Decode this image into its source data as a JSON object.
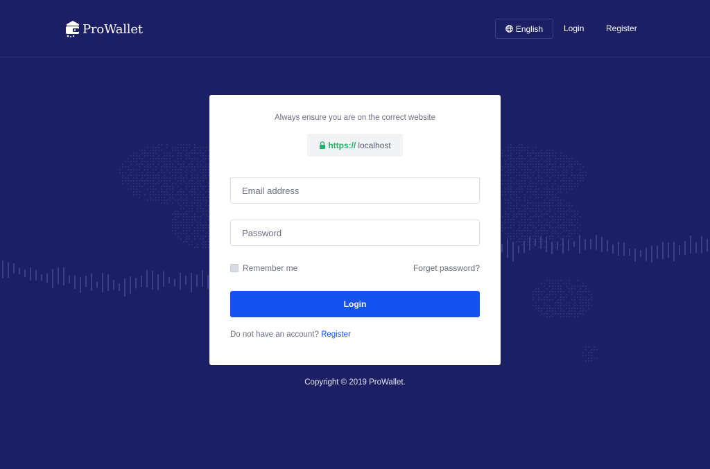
{
  "header": {
    "logo_text": "ProWallet",
    "language_label": "English",
    "login_link": "Login",
    "register_link": "Register"
  },
  "card": {
    "notice": "Always ensure you are on the correct website",
    "url_protocol": "https://",
    "url_host": "localhost",
    "email_placeholder": "Email address",
    "password_placeholder": "Password",
    "remember_label": "Remember me",
    "forget_label": "Forget password?",
    "login_button": "Login",
    "signup_prompt": "Do not have an account?",
    "signup_link": "Register"
  },
  "footer": {
    "copyright": "Copyright © 2019 ProWallet."
  },
  "colors": {
    "background": "#1c1f63",
    "accent": "#1652f0",
    "secure": "#1fb36b"
  },
  "icons": {
    "language": "globe-icon",
    "secure": "lock-icon",
    "logo": "wallet-logo-icon"
  }
}
